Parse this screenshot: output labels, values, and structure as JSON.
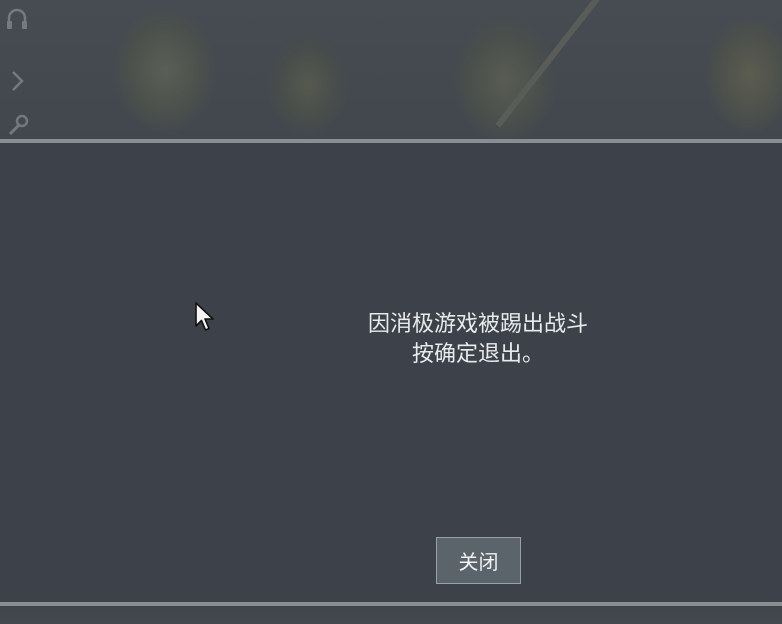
{
  "dialog": {
    "message_line1": "因消极游戏被踢出战斗",
    "message_line2": "按确定退出。",
    "close_label": "关闭"
  },
  "side_icons": [
    "headset-icon",
    "chevron-right-icon",
    "wrench-icon"
  ],
  "colors": {
    "overlay": "#3d424a",
    "border": "#8a8d91",
    "button_bg": "#5b636b",
    "text": "#e8eaec"
  }
}
